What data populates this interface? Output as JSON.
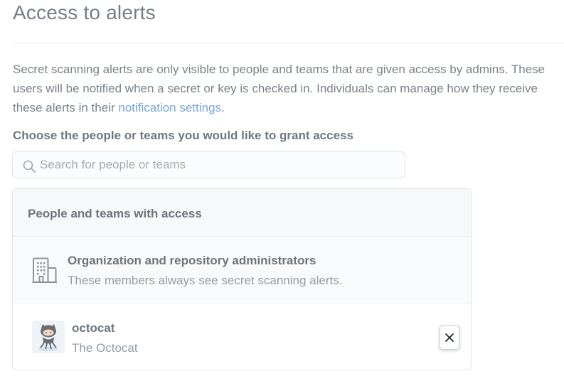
{
  "section": {
    "title": "Access to alerts",
    "description_before_link": "Secret scanning alerts are only visible to people and teams that are given access by admins. These users will be notified when a secret or key is checked in. Individuals can manage how they receive these alerts in their ",
    "description_link": "notification settings",
    "description_after_link": "."
  },
  "grant": {
    "label": "Choose the people or teams you would like to grant access",
    "search_placeholder": "Search for people or teams",
    "search_value": "",
    "search_icon": "search-icon"
  },
  "access_list": {
    "header": "People and teams with access",
    "admins": {
      "icon": "organization-icon",
      "title": "Organization and repository administrators",
      "subtitle": "These members always see secret scanning alerts."
    },
    "users": [
      {
        "login": "octocat",
        "name": "The Octocat",
        "avatar_icon": "octocat-avatar",
        "remove_icon": "close-icon"
      }
    ]
  },
  "colors": {
    "link": "#79a5d9",
    "title": "#767d84",
    "muted_text": "#959ca3",
    "panel_header_bg": "#f7f8fa",
    "border": "#e1e4e8"
  }
}
